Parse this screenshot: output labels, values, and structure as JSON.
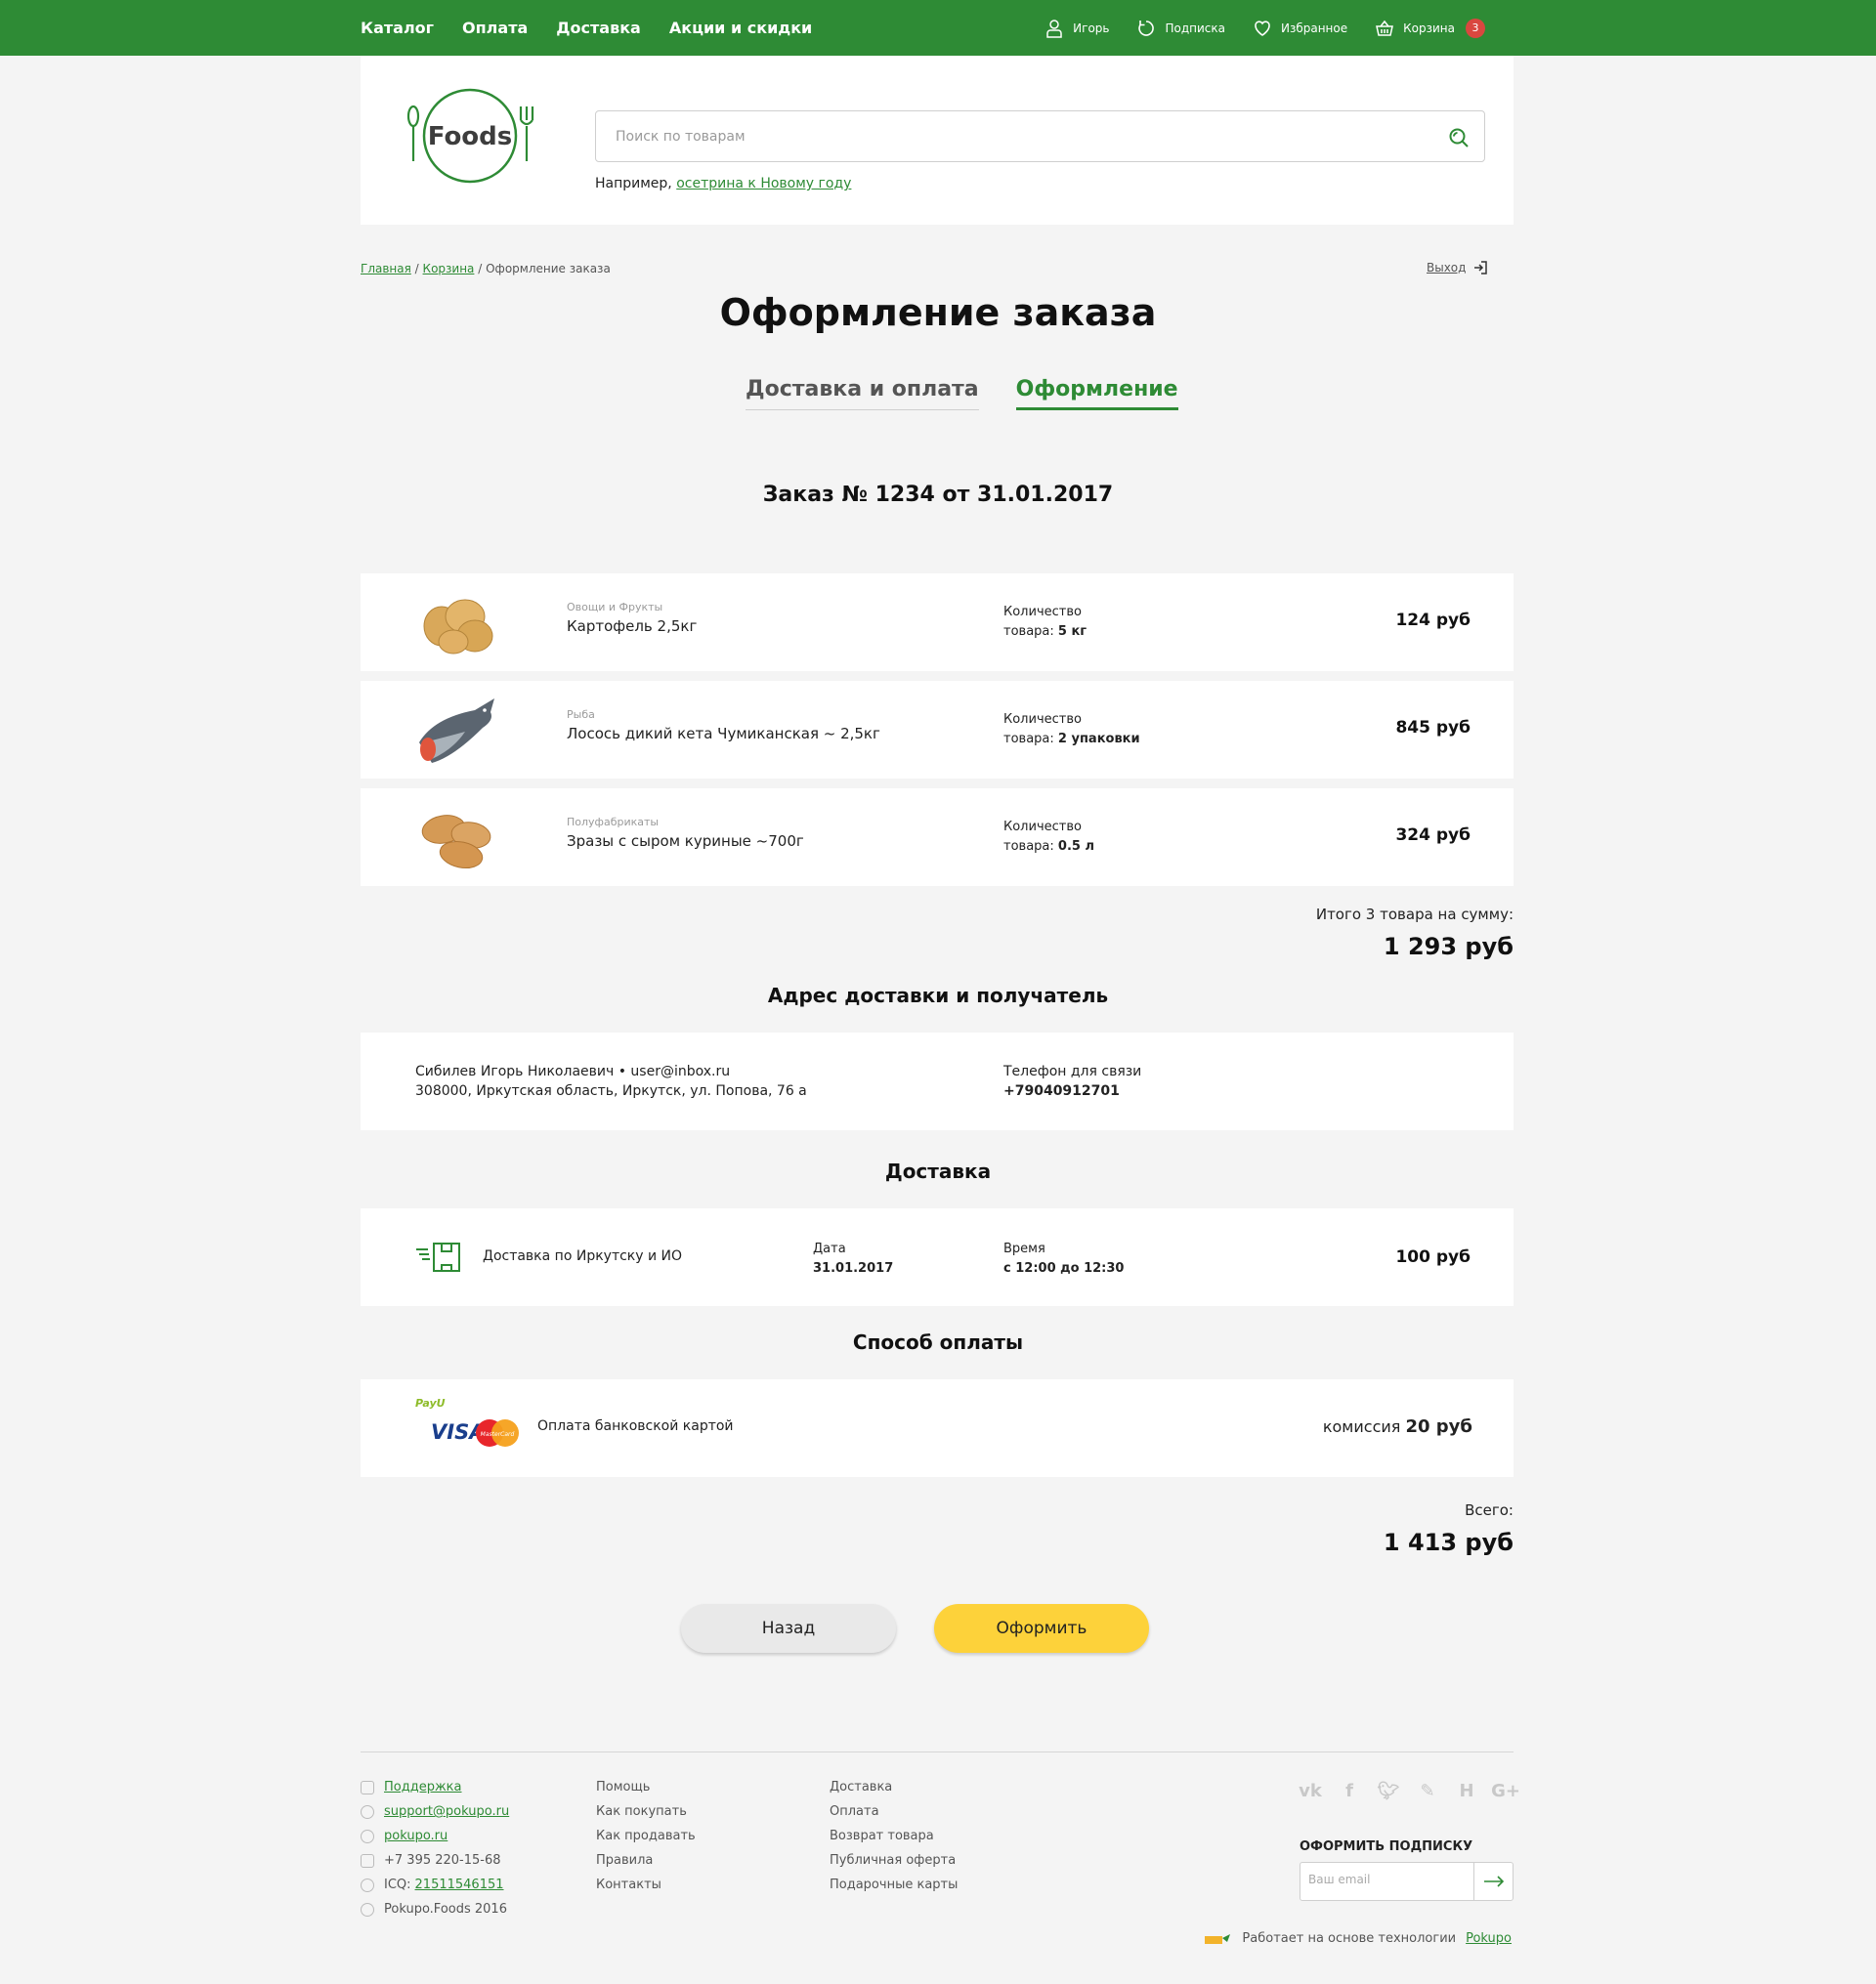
{
  "topnav": [
    "Каталог",
    "Оплата",
    "Доставка",
    "Акции и скидки"
  ],
  "toptools": {
    "user": "Игорь",
    "subscription": "Подписка",
    "favorites": "Избранное",
    "cart": "Корзина",
    "cart_count": "3"
  },
  "logo_text": "Foods",
  "search": {
    "placeholder": "Поиск по товарам",
    "example_prefix": "Например,",
    "example_link": "осетрина к Новому году"
  },
  "breadcrumbs": {
    "home": "Главная",
    "cart": "Корзина",
    "current": "Оформление заказа",
    "sep": "/"
  },
  "logout": "Выход",
  "page_title": "Оформление заказа",
  "steps": [
    "Доставка и оплата",
    "Оформление"
  ],
  "order_title": "Заказ № 1234 от 31.01.2017",
  "qty_label_1": "Количество",
  "qty_label_2": "товара:",
  "items": [
    {
      "category": "Овощи и Фрукты",
      "name": "Картофель 2,5кг",
      "qty": "5 кг",
      "price": "124 руб"
    },
    {
      "category": "Рыба",
      "name": "Лосось дикий кета Чумиканская ~ 2,5кг",
      "qty": "2 упаковки",
      "price": "845 руб"
    },
    {
      "category": "Полуфабрикаты",
      "name": "Зразы с сыром куриные ~700г",
      "qty": "0.5 л",
      "price": "324 руб"
    }
  ],
  "subtotal": {
    "label": "Итого 3 товара на сумму:",
    "value": "1 293 руб"
  },
  "address_title": "Адрес доставки и получатель",
  "address": {
    "line1": "Сибилев Игорь Николаевич • user@inbox.ru",
    "line2": "308000, Иркутская область, Иркутск, ул. Попова, 76 а",
    "phone_label": "Телефон для связи",
    "phone": "+79040912701"
  },
  "delivery_title": "Доставка",
  "delivery": {
    "name": "Доставка по Иркутску и ИО",
    "date_label": "Дата",
    "date": "31.01.2017",
    "time_label": "Время",
    "time": "с 12:00 до 12:30",
    "price": "100 руб"
  },
  "payment_title": "Способ оплаты",
  "payment": {
    "payu": "PayU",
    "visa": "VISA",
    "mastercard": "MasterCard",
    "name": "Оплата банковской картой",
    "commission_label": "комиссия",
    "commission": "20 руб"
  },
  "total": {
    "label": "Всего:",
    "value": "1 413 руб"
  },
  "buttons": {
    "back": "Назад",
    "submit": "Оформить"
  },
  "footer": {
    "contacts": {
      "support": "Поддержка",
      "email": "support@pokupo.ru",
      "skype": "pokupo.ru",
      "phone": "+7 395 220-15-68",
      "icq_label": "ICQ:",
      "icq": "21511546151",
      "copyright": "Pokupo.Foods 2016"
    },
    "col2": [
      "Помощь",
      "Как покупать",
      "Как продавать",
      "Правила",
      "Контакты"
    ],
    "col3": [
      "Доставка",
      "Оплата",
      "Возврат товара",
      "Публичная оферта",
      "Подарочные карты"
    ],
    "social": [
      "vk-icon",
      "facebook-icon",
      "twitter-icon",
      "livejournal-icon",
      "habr-icon",
      "google-plus-icon"
    ],
    "subscribe_label": "ОФОРМИТЬ ПОДПИСКУ",
    "subscribe_placeholder": "Ваш email",
    "powered_text": "Работает на основе технологии",
    "powered_link": "Pokupo"
  },
  "colors": {
    "brand_green": "#2e8b35",
    "accent_yellow": "#fdd23a",
    "badge_red": "#d9473f"
  }
}
